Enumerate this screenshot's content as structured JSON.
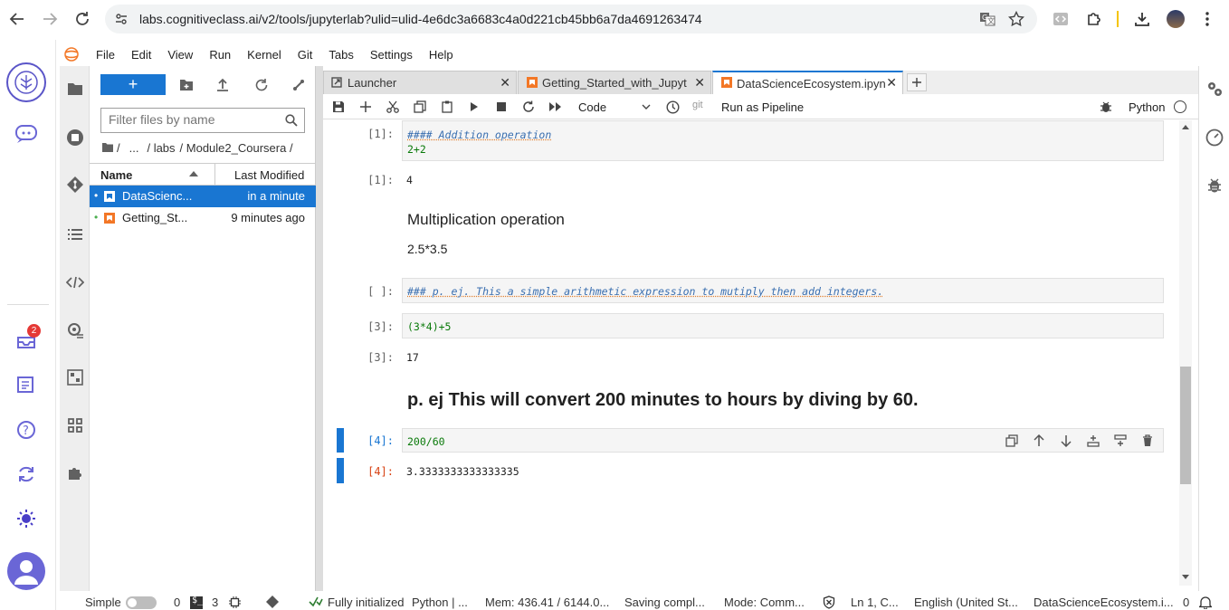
{
  "browser": {
    "url": "labs.cognitiveclass.ai/v2/tools/jupyterlab?ulid=ulid-4e6dc3a6683c4a0d221cb45bb6a7da4691263474"
  },
  "rail": {
    "notifications_count": "2"
  },
  "menu": [
    "File",
    "Edit",
    "View",
    "Run",
    "Kernel",
    "Git",
    "Tabs",
    "Settings",
    "Help"
  ],
  "filebrowser": {
    "new_label": "+",
    "filter_placeholder": "Filter files by name",
    "breadcrumb_root": "/",
    "breadcrumb_ellipsis": "...",
    "breadcrumb_labs": "/ labs",
    "breadcrumb_module": "/ Module2_Coursera /",
    "col_name": "Name",
    "col_modified": "Last Modified",
    "files": [
      {
        "name": "DataScienc...",
        "modified": "in a minute"
      },
      {
        "name": "Getting_St...",
        "modified": "9 minutes ago"
      }
    ]
  },
  "tabs": [
    {
      "label": "Launcher"
    },
    {
      "label": "Getting_Started_with_Jupyt"
    },
    {
      "label": "DataScienceEcosystem.ipyn"
    }
  ],
  "toolbar": {
    "cell_type": "Code",
    "git": "git",
    "run_pipeline": "Run as Pipeline",
    "kernel": "Python"
  },
  "cells": {
    "c1_prompt": "[1]:",
    "c1_line1": "#### Addition operation",
    "c1_line2": "2+2",
    "o1_prompt": "[1]:",
    "o1_text": "4",
    "md1_heading": "Multiplication operation",
    "md1_text": "2.5*3.5",
    "c2_prompt": "[ ]:",
    "c2_text": "### p. ej. This a simple arithmetic expression to mutiply then add integers.",
    "c3_prompt": "[3]:",
    "c3_text": "(3*4)+5",
    "o3_prompt": "[3]:",
    "o3_text": "17",
    "md2_heading": "p. ej This will convert 200 minutes to hours by diving by 60.",
    "c4_prompt": "[4]:",
    "c4_text": "200/60",
    "o4_prompt": "[4]:",
    "o4_text": "3.3333333333333335"
  },
  "status": {
    "simple": "Simple",
    "zero": "0",
    "three": "3",
    "initialized": "Fully initialized",
    "python": "Python | ...",
    "mem": "Mem: 436.41 / 6144.0...",
    "saving": "Saving compl...",
    "mode": "Mode: Comm...",
    "ln": "Ln 1, C...",
    "lang": "English (United St...",
    "file": "DataScienceEcosystem.i...",
    "notif": "0"
  }
}
